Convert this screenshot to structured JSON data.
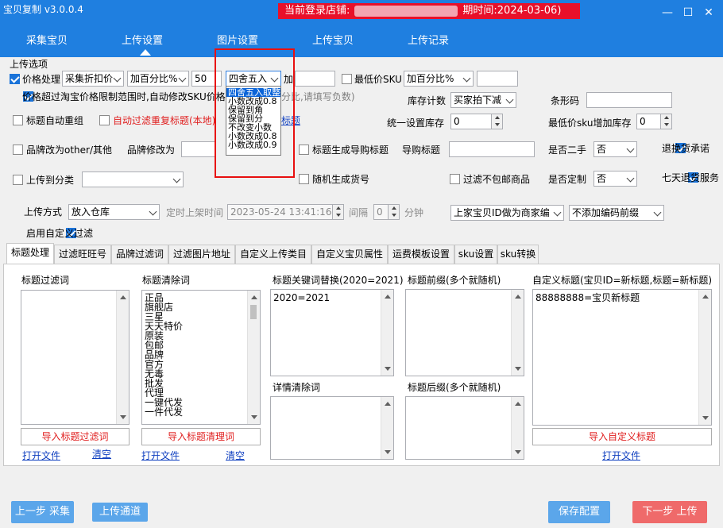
{
  "window": {
    "title": "宝贝复制 v3.0.0.4",
    "login_banner_prefix": "当前登录店铺:",
    "login_banner_suffix": "期时间:2024-03-06)",
    "min_glyph": "—",
    "max_glyph": "☐",
    "close_glyph": "✕"
  },
  "nav": {
    "tabs": [
      "采集宝贝",
      "上传设置",
      "图片设置",
      "上传宝贝",
      "上传记录"
    ],
    "active_index": 1
  },
  "section": {
    "title": "上传选项"
  },
  "row1": {
    "price_process_label": "价格处理",
    "price_mode": "采集折扣价",
    "price_add_mode": "加百分比%",
    "price_value": "50",
    "rounding": "四舍五入",
    "add_label": "加",
    "add_value": "",
    "min_price_sku_label": "最低价SKU",
    "min_price_add_mode": "加百分比%",
    "min_price_value": ""
  },
  "row2": {
    "over_limit_label": "价格超过淘宝价格限制范围时,自动修改SKU价格",
    "over_limit_hint": "分比,请填写负数)",
    "stock_count_label": "库存计数",
    "stock_count_mode": "买家拍下减",
    "barcode_label": "条形码",
    "barcode_value": ""
  },
  "row3": {
    "title_regroup_label": "标题自动重组",
    "auto_filter_dup_label": "自动过滤重复标题(本地)",
    "filter_title_link": "过滤标题",
    "unify_stock_label": "统一设置库存",
    "unify_stock_value": "0",
    "min_price_sku_stock_label": "最低价sku增加库存",
    "min_price_sku_stock_value": "0"
  },
  "row4": {
    "brand_other_label": "品牌改为other/其他",
    "brand_change_label": "品牌修改为",
    "brand_value": "",
    "title_gen_shopping_label": "标题生成导购标题",
    "shopping_title_label": "导购标题",
    "shopping_title_value": "",
    "second_hand_label": "是否二手",
    "second_hand_value": "否",
    "return_promise_label": "退换货承诺"
  },
  "row5": {
    "upload_category_label": "上传到分类",
    "category_value": "",
    "random_item_no_label": "随机生成货号",
    "filter_no_free_ship_label": "过滤不包邮商品",
    "custom_made_label": "是否定制",
    "custom_made_value": "否",
    "seven_day_label": "七天退货服务"
  },
  "row6": {
    "upload_method_label": "上传方式",
    "upload_method_value": "放入仓库",
    "schedule_label": "定时上架时间",
    "schedule_value": "2023-05-24 13:41:16",
    "interval_label": "间隔",
    "interval_value": "0",
    "minute_label": "分钟",
    "merchant_code_mode": "上家宝贝ID做为商家编",
    "code_prefix_mode": "不添加编码前缀"
  },
  "custom_filter": {
    "label": "启用自定义过滤"
  },
  "subtabs": [
    "标题处理",
    "过滤旺旺号",
    "品牌过滤词",
    "过滤图片地址",
    "自定义上传类目",
    "自定义宝贝属性",
    "运费模板设置",
    "sku设置",
    "sku转换"
  ],
  "panels": {
    "title_filter": {
      "label": "标题过滤词",
      "lines": [],
      "import_button": "导入标题过滤词",
      "open_link": "打开文件",
      "clear_link": "清空"
    },
    "title_clear": {
      "label": "标题清除词",
      "lines": [
        "正品",
        "旗舰店",
        "三星",
        "天天特价",
        "原装",
        "包邮",
        "品牌",
        "官方",
        "无毒",
        "批发",
        "代理",
        "一键代发",
        "一件代发"
      ],
      "import_button": "导入标题清理词",
      "open_link": "打开文件",
      "clear_link": "清空"
    },
    "keyword_replace": {
      "label": "标题关键词替换(2020=2021)",
      "lines": [
        "2020=2021"
      ]
    },
    "detail_clear": {
      "label": "详情清除词",
      "lines": []
    },
    "title_prefix": {
      "label": "标题前缀(多个就随机)",
      "lines": []
    },
    "title_suffix": {
      "label": "标题后缀(多个就随机)",
      "lines": []
    },
    "custom_title": {
      "label": "自定义标题(宝贝ID=新标题,标题=新标题)",
      "lines": [
        "88888888=宝贝新标题"
      ],
      "import_button": "导入自定义标题",
      "open_link": "打开文件"
    }
  },
  "bottom": {
    "prev_button": "上一步 采集",
    "channel_button": "上传通道",
    "save_button": "保存配置",
    "next_button": "下一步 上传"
  },
  "rounding_dropdown": {
    "options": [
      "四舍五入取整",
      "小数改成0.8",
      "保留到角",
      "保留到分",
      "不改变小数",
      "小数改成0.8",
      "小数改成0.9"
    ],
    "highlighted_index": 0
  },
  "colors": {
    "title_bar": "#1f7fe0",
    "banner_red": "#e8102a",
    "prev_button": "#5ba6ea",
    "next_button": "#ef6a6a",
    "highlight_box": "#e81010",
    "accent_blue": "#1a73d9"
  },
  "icons": {
    "checked": "checkbox-checked-icon",
    "unchecked": "checkbox-unchecked-icon",
    "dropdown": "chevron-down-icon"
  }
}
